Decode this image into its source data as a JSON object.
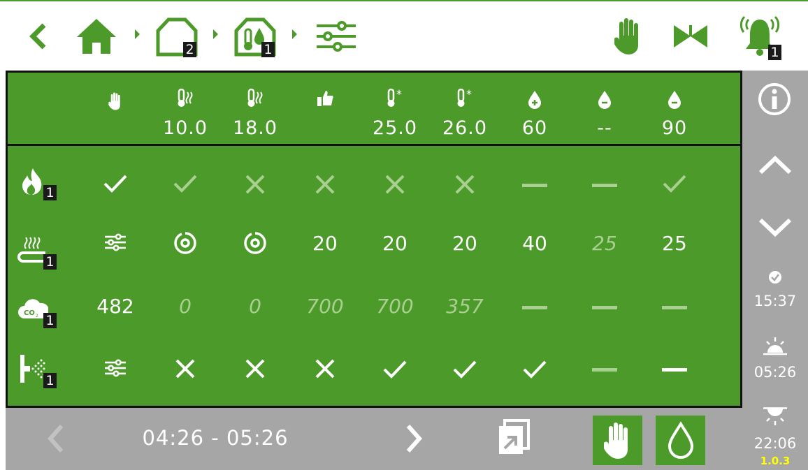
{
  "colors": {
    "green": "#4c9a2a",
    "gray": "#a6a6a6",
    "dim": "#a9d090",
    "border": "#111111",
    "version": "#ffff00"
  },
  "topbar": {
    "icons": [
      "back-chevron-icon",
      "home-icon",
      "greenhouse-icon",
      "climate-zone-icon",
      "settings-sliders-icon",
      "manual-hand-icon",
      "valve-icon",
      "alarm-bell-icon"
    ],
    "greenhouse_badge": "2",
    "zone_badge": "1",
    "alarm_badge": "1"
  },
  "header": {
    "columns": [
      {
        "icon": "hand-icon",
        "value": ""
      },
      {
        "icon": "thermometer-heat-icon",
        "value": "10.0"
      },
      {
        "icon": "thermometer-heat-icon",
        "value": "18.0"
      },
      {
        "icon": "thumbs-up-icon",
        "value": ""
      },
      {
        "icon": "thermometer-sun-icon",
        "value": "25.0"
      },
      {
        "icon": "thermometer-sun-icon",
        "value": "26.0"
      },
      {
        "icon": "humidity-plus-icon",
        "value": "60"
      },
      {
        "icon": "humidity-minus-icon",
        "value": "--"
      },
      {
        "icon": "humidity-minus-icon",
        "value": "90"
      }
    ]
  },
  "rows": [
    {
      "icon": "heating-flame-icon",
      "badge": "1",
      "cells": [
        {
          "type": "check",
          "dim": false
        },
        {
          "type": "check",
          "dim": true
        },
        {
          "type": "cross",
          "dim": true
        },
        {
          "type": "cross",
          "dim": true
        },
        {
          "type": "cross",
          "dim": true
        },
        {
          "type": "cross",
          "dim": true
        },
        {
          "type": "dash",
          "dim": true
        },
        {
          "type": "dash",
          "dim": true
        },
        {
          "type": "check",
          "dim": true
        }
      ]
    },
    {
      "icon": "heating-pipe-icon",
      "badge": "1",
      "cells": [
        {
          "type": "sliders"
        },
        {
          "type": "swirl"
        },
        {
          "type": "swirl"
        },
        {
          "type": "text",
          "text": "20"
        },
        {
          "type": "text",
          "text": "20"
        },
        {
          "type": "text",
          "text": "20"
        },
        {
          "type": "text",
          "text": "40"
        },
        {
          "type": "text",
          "text": "25",
          "italic": true
        },
        {
          "type": "text",
          "text": "25"
        }
      ]
    },
    {
      "icon": "co2-cloud-icon",
      "badge": "1",
      "cells": [
        {
          "type": "text",
          "text": "482"
        },
        {
          "type": "text",
          "text": "0",
          "italic": true
        },
        {
          "type": "text",
          "text": "0",
          "italic": true
        },
        {
          "type": "text",
          "text": "700",
          "italic": true
        },
        {
          "type": "text",
          "text": "700",
          "italic": true
        },
        {
          "type": "text",
          "text": "357",
          "italic": true
        },
        {
          "type": "dash",
          "dim": true
        },
        {
          "type": "dash",
          "dim": true
        },
        {
          "type": "dash",
          "dim": true
        }
      ]
    },
    {
      "icon": "misting-sprayer-icon",
      "badge": "1",
      "cells": [
        {
          "type": "sliders"
        },
        {
          "type": "cross",
          "dim": false
        },
        {
          "type": "cross",
          "dim": false
        },
        {
          "type": "cross",
          "dim": false
        },
        {
          "type": "check",
          "dim": false
        },
        {
          "type": "check",
          "dim": false
        },
        {
          "type": "check",
          "dim": false
        },
        {
          "type": "dash",
          "dim": true
        },
        {
          "type": "dash",
          "dim": false
        }
      ]
    }
  ],
  "footer": {
    "time_range": "04:26 - 05:26"
  },
  "sidebar": {
    "clock_time": "15:37",
    "sunrise_time": "05:26",
    "sunset_time": "22:06",
    "version": "1.0.3"
  }
}
